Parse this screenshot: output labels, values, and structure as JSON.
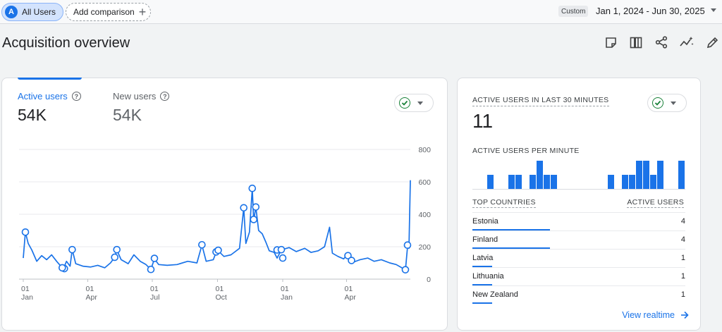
{
  "topbar": {
    "segment_chip": {
      "avatar_letter": "A",
      "label": "All Users"
    },
    "add_comparison": {
      "label": "Add comparison"
    },
    "date": {
      "badge": "Custom",
      "range": "Jan 1, 2024 - Jun 30, 2025"
    }
  },
  "page": {
    "title": "Acquisition overview"
  },
  "toolbar_icons": [
    "notes-icon",
    "compare-icon",
    "share-icon",
    "insights-icon",
    "edit-icon"
  ],
  "summary": {
    "active_users": {
      "label": "Active users",
      "value": "54K"
    },
    "new_users": {
      "label": "New users",
      "value": "54K"
    }
  },
  "colors": {
    "accent": "#1a73e8",
    "check_green": "#188038"
  },
  "chart_data": {
    "type": "line",
    "title": "",
    "xlabel": "",
    "ylabel": "",
    "x_start": "2024-01-01",
    "x_end": "2025-06-30",
    "x_ticks": [
      {
        "date": "2024-01-01",
        "day": "01",
        "month": "Jan"
      },
      {
        "date": "2024-04-01",
        "day": "01",
        "month": "Apr"
      },
      {
        "date": "2024-07-01",
        "day": "01",
        "month": "Jul"
      },
      {
        "date": "2024-10-01",
        "day": "01",
        "month": "Oct"
      },
      {
        "date": "2025-01-01",
        "day": "01",
        "month": "Jan"
      },
      {
        "date": "2025-04-01",
        "day": "01",
        "month": "Apr"
      }
    ],
    "y_ticks": [
      0,
      200,
      400,
      600,
      800
    ],
    "ylim": [
      0,
      800
    ],
    "grid": true,
    "y_axis_side": "right",
    "series": [
      {
        "color": "#1a73e8",
        "points": [
          [
            "2024-01-01",
            130
          ],
          [
            "2024-01-04",
            290
          ],
          [
            "2024-01-08",
            220
          ],
          [
            "2024-01-13",
            180
          ],
          [
            "2024-01-20",
            110
          ],
          [
            "2024-01-27",
            145
          ],
          [
            "2024-02-03",
            120
          ],
          [
            "2024-02-10",
            150
          ],
          [
            "2024-02-17",
            110
          ],
          [
            "2024-02-24",
            75
          ],
          [
            "2024-02-27",
            68
          ],
          [
            "2024-03-02",
            110
          ],
          [
            "2024-03-07",
            80
          ],
          [
            "2024-03-10",
            182
          ],
          [
            "2024-03-15",
            95
          ],
          [
            "2024-03-25",
            80
          ],
          [
            "2024-04-05",
            75
          ],
          [
            "2024-04-15",
            85
          ],
          [
            "2024-04-25",
            70
          ],
          [
            "2024-05-03",
            100
          ],
          [
            "2024-05-09",
            135
          ],
          [
            "2024-05-12",
            180
          ],
          [
            "2024-05-18",
            120
          ],
          [
            "2024-05-28",
            95
          ],
          [
            "2024-06-05",
            150
          ],
          [
            "2024-06-14",
            110
          ],
          [
            "2024-06-22",
            90
          ],
          [
            "2024-06-29",
            60
          ],
          [
            "2024-07-04",
            125
          ],
          [
            "2024-07-10",
            90
          ],
          [
            "2024-07-22",
            85
          ],
          [
            "2024-08-05",
            90
          ],
          [
            "2024-08-20",
            110
          ],
          [
            "2024-09-02",
            100
          ],
          [
            "2024-09-09",
            210
          ],
          [
            "2024-09-15",
            110
          ],
          [
            "2024-09-25",
            120
          ],
          [
            "2024-09-29",
            165
          ],
          [
            "2024-10-02",
            175
          ],
          [
            "2024-10-10",
            140
          ],
          [
            "2024-10-20",
            150
          ],
          [
            "2024-11-01",
            190
          ],
          [
            "2024-11-07",
            440
          ],
          [
            "2024-11-10",
            220
          ],
          [
            "2024-11-15",
            290
          ],
          [
            "2024-11-19",
            560
          ],
          [
            "2024-11-21",
            360
          ],
          [
            "2024-11-24",
            445
          ],
          [
            "2024-11-28",
            300
          ],
          [
            "2024-12-03",
            280
          ],
          [
            "2024-12-08",
            230
          ],
          [
            "2024-12-13",
            175
          ],
          [
            "2024-12-20",
            165
          ],
          [
            "2024-12-24",
            130
          ],
          [
            "2024-12-30",
            180
          ],
          [
            "2025-01-10",
            195
          ],
          [
            "2025-01-20",
            170
          ],
          [
            "2025-02-01",
            190
          ],
          [
            "2025-02-10",
            165
          ],
          [
            "2025-02-20",
            175
          ],
          [
            "2025-03-01",
            200
          ],
          [
            "2025-03-08",
            320
          ],
          [
            "2025-03-12",
            160
          ],
          [
            "2025-03-20",
            140
          ],
          [
            "2025-03-28",
            125
          ],
          [
            "2025-04-03",
            160
          ],
          [
            "2025-04-08",
            100
          ],
          [
            "2025-04-20",
            120
          ],
          [
            "2025-05-01",
            130
          ],
          [
            "2025-05-10",
            110
          ],
          [
            "2025-05-20",
            120
          ],
          [
            "2025-06-01",
            100
          ],
          [
            "2025-06-10",
            90
          ],
          [
            "2025-06-18",
            70
          ],
          [
            "2025-06-23",
            55
          ],
          [
            "2025-06-26",
            200
          ],
          [
            "2025-06-28",
            190
          ],
          [
            "2025-06-30",
            610
          ]
        ]
      }
    ],
    "annotation_markers": [
      [
        "2024-01-04",
        290
      ],
      [
        "2024-02-28",
        65
      ],
      [
        "2024-03-10",
        182
      ],
      [
        "2024-02-25",
        70
      ],
      [
        "2024-05-12",
        182
      ],
      [
        "2024-05-09",
        135
      ],
      [
        "2024-06-29",
        60
      ],
      [
        "2024-07-04",
        128
      ],
      [
        "2024-09-09",
        212
      ],
      [
        "2024-09-29",
        168
      ],
      [
        "2024-10-02",
        178
      ],
      [
        "2024-11-07",
        440
      ],
      [
        "2024-11-19",
        560
      ],
      [
        "2024-11-21",
        368
      ],
      [
        "2024-11-24",
        445
      ],
      [
        "2024-12-24",
        180
      ],
      [
        "2024-12-30",
        182
      ],
      [
        "2025-01-01",
        130
      ],
      [
        "2025-04-03",
        145
      ],
      [
        "2025-04-08",
        115
      ],
      [
        "2025-06-23",
        58
      ],
      [
        "2025-06-26",
        210
      ]
    ]
  },
  "realtime": {
    "title": "ACTIVE USERS IN LAST 30 MINUTES",
    "value": "11",
    "per_minute_label": "ACTIVE USERS PER MINUTE",
    "per_minute": [
      0,
      0,
      1,
      0,
      0,
      1,
      1,
      0,
      1,
      2,
      1,
      1,
      0,
      0,
      0,
      0,
      0,
      0,
      0,
      1,
      0,
      1,
      1,
      2,
      2,
      1,
      2,
      0,
      0,
      2
    ],
    "table": {
      "col_country": "TOP COUNTRIES",
      "col_users": "ACTIVE USERS",
      "rows": [
        {
          "country": "Estonia",
          "users": "4",
          "share": 1.0
        },
        {
          "country": "Finland",
          "users": "4",
          "share": 1.0
        },
        {
          "country": "Latvia",
          "users": "1",
          "share": 0.25
        },
        {
          "country": "Lithuania",
          "users": "1",
          "share": 0.25
        },
        {
          "country": "New Zealand",
          "users": "1",
          "share": 0.25
        }
      ]
    },
    "link": "View realtime"
  }
}
